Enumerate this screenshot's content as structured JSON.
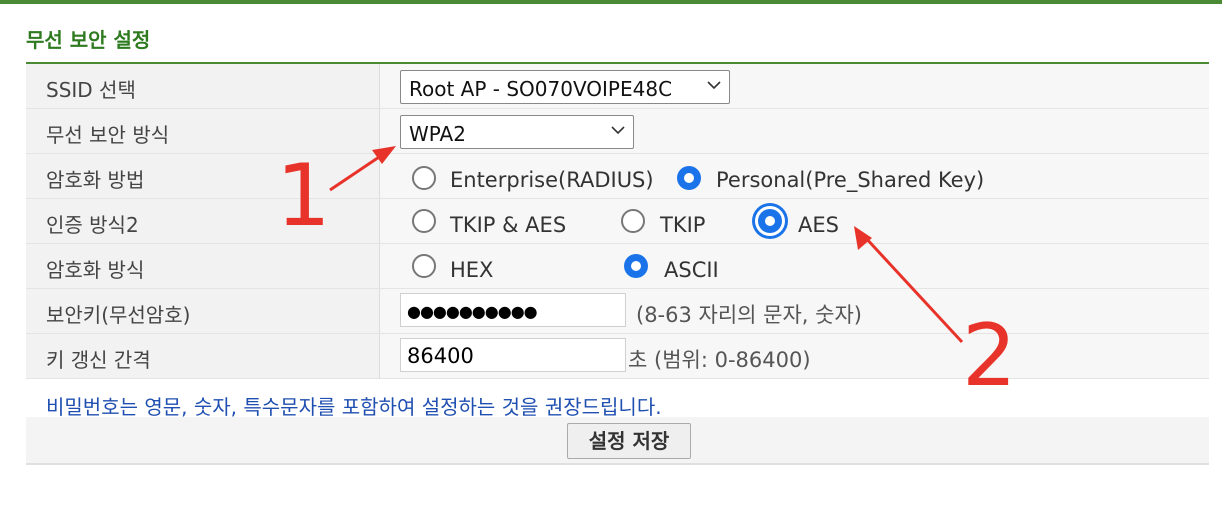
{
  "page": {
    "title": "무선 보안 설정"
  },
  "rows": {
    "ssid": {
      "label": "SSID 선택",
      "value": "Root AP - SO070VOIPE48C"
    },
    "security_mode": {
      "label": "무선 보안 방식",
      "value": "WPA2"
    },
    "encryption_method": {
      "label": "암호화 방법",
      "options": [
        {
          "label": "Enterprise(RADIUS)",
          "selected": false
        },
        {
          "label": "Personal(Pre_Shared Key)",
          "selected": true
        }
      ]
    },
    "auth_mode": {
      "label": "인증 방식2",
      "options": [
        {
          "label": "TKIP & AES",
          "selected": false
        },
        {
          "label": "TKIP",
          "selected": false
        },
        {
          "label": "AES",
          "selected": true
        }
      ]
    },
    "key_format": {
      "label": "암호화 방식",
      "options": [
        {
          "label": "HEX",
          "selected": false
        },
        {
          "label": "ASCII",
          "selected": true
        }
      ]
    },
    "security_key": {
      "label": "보안키(무선암호)",
      "value": "●●●●●●●●●●",
      "hint": "(8-63 자리의 문자, 숫자)"
    },
    "key_renewal": {
      "label": "키 갱신 간격",
      "value": "86400",
      "hint": "초 (범위: 0-86400)"
    }
  },
  "notice": "비밀번호는 영문, 숫자, 특수문자를 포함하여 설정하는 것을 권장드립니다.",
  "save_button": "설정 저장",
  "annotations": {
    "one": "1",
    "two": "2",
    "color": "#e8332a"
  },
  "colors": {
    "accent_green": "#4a8a35",
    "title_green": "#2d7a1f",
    "radio_blue": "#1a73e8",
    "notice_blue": "#1f4fb0"
  }
}
